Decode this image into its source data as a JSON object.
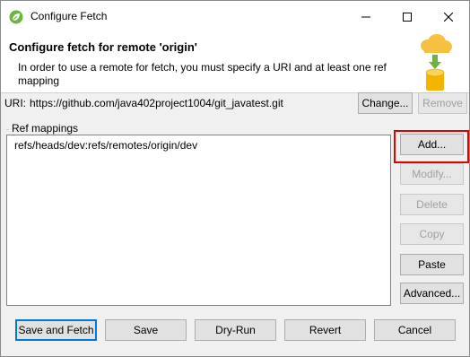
{
  "window": {
    "title": "Configure Fetch",
    "controls": {
      "minimize": "minimize-icon",
      "maximize": "maximize-icon",
      "close": "close-icon"
    }
  },
  "header": {
    "title": "Configure fetch for remote 'origin'",
    "description": "In order to use a remote for fetch, you must specify a URI and at least one ref mapping",
    "graphic_icon": "cloud-upload-database-icon"
  },
  "uri": {
    "label": "URI:",
    "value": "https://github.com/java402project1004/git_javatest.git",
    "change_label": "Change...",
    "remove_label": "Remove"
  },
  "ref_mappings": {
    "label": "Ref mappings",
    "items": [
      "refs/heads/dev:refs/remotes/origin/dev"
    ],
    "add_label": "Add...",
    "modify_label": "Modify...",
    "delete_label": "Delete",
    "copy_label": "Copy",
    "paste_label": "Paste",
    "advanced_label": "Advanced..."
  },
  "footer": {
    "save_fetch_label": "Save and Fetch",
    "save_label": "Save",
    "dry_run_label": "Dry-Run",
    "revert_label": "Revert",
    "cancel_label": "Cancel"
  },
  "colors": {
    "accent": "#0078d7",
    "highlight": "#e00000",
    "leaf": "#6db33f",
    "cloud": "#f6c141"
  }
}
